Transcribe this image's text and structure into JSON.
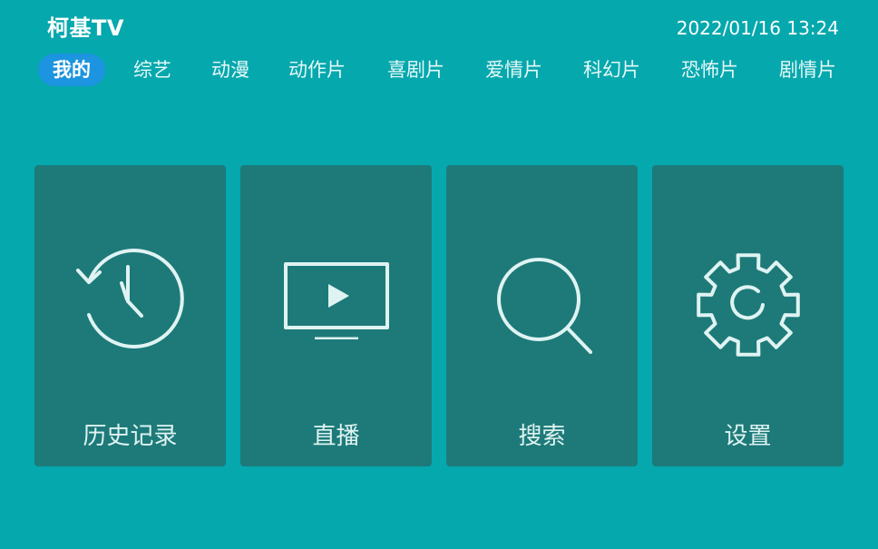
{
  "header": {
    "app_title": "柯基TV",
    "datetime": "2022/01/16 13:24"
  },
  "tabs": [
    {
      "label": "我的",
      "active": true
    },
    {
      "label": "综艺",
      "active": false
    },
    {
      "label": "动漫",
      "active": false
    },
    {
      "label": "动作片",
      "active": false
    },
    {
      "label": "喜剧片",
      "active": false
    },
    {
      "label": "爱情片",
      "active": false
    },
    {
      "label": "科幻片",
      "active": false
    },
    {
      "label": "恐怖片",
      "active": false
    },
    {
      "label": "剧情片",
      "active": false
    }
  ],
  "tiles": [
    {
      "label": "历史记录",
      "icon": "history-icon"
    },
    {
      "label": "直播",
      "icon": "live-tv-icon"
    },
    {
      "label": "搜索",
      "icon": "search-icon"
    },
    {
      "label": "设置",
      "icon": "gear-icon"
    }
  ],
  "colors": {
    "background": "#05a8ad",
    "tile": "#1d7a79",
    "active_tab": "#1c94df",
    "icon_stroke": "#dff3f2"
  }
}
